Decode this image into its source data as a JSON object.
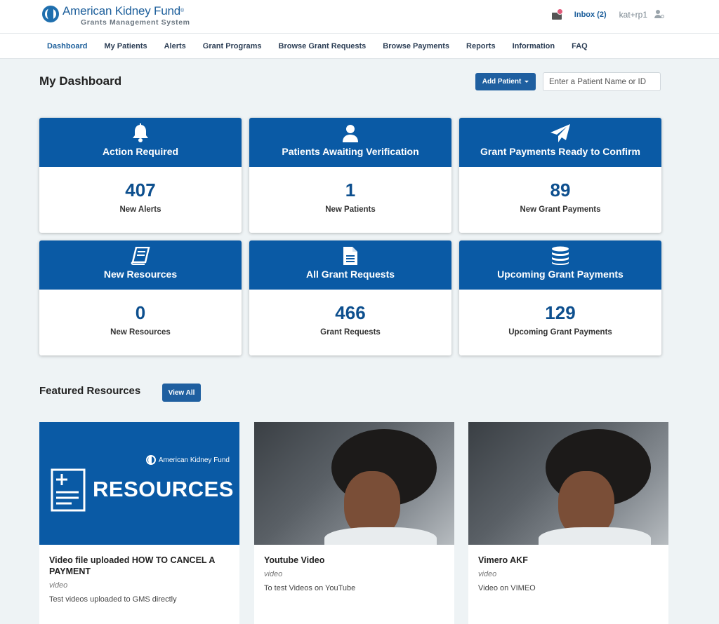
{
  "header": {
    "logo_name": "American Kidney Fund",
    "logo_reg": "®",
    "logo_sub": "Grants Management System",
    "inbox": "Inbox (2)",
    "user": "kat+rp1"
  },
  "nav": [
    "Dashboard",
    "My Patients",
    "Alerts",
    "Grant Programs",
    "Browse Grant Requests",
    "Browse Payments",
    "Reports",
    "Information",
    "FAQ"
  ],
  "page": {
    "title": "My Dashboard",
    "add_patient": "Add Patient",
    "search_placeholder": "Enter a Patient Name or ID"
  },
  "cards": [
    {
      "icon": "bell-icon",
      "label": "Action Required",
      "value": "407",
      "sub": "New Alerts"
    },
    {
      "icon": "user-icon",
      "label": "Patients Awaiting Verification",
      "value": "1",
      "sub": "New Patients"
    },
    {
      "icon": "paper-plane-icon",
      "label": "Grant Payments Ready to Confirm",
      "value": "89",
      "sub": "New Grant Payments"
    },
    {
      "icon": "book-icon",
      "label": "New Resources",
      "value": "0",
      "sub": "New Resources"
    },
    {
      "icon": "document-icon",
      "label": "All Grant Requests",
      "value": "466",
      "sub": "Grant Requests"
    },
    {
      "icon": "coins-icon",
      "label": "Upcoming Grant Payments",
      "value": "129",
      "sub": "Upcoming Grant Payments"
    }
  ],
  "featured": {
    "title": "Featured Resources",
    "view_all": "View All",
    "thumb_brand": "American Kidney Fund",
    "thumb_word": "RESOURCES",
    "items": [
      {
        "title": "Video file uploaded HOW TO CANCEL A PAYMENT",
        "type": "video",
        "desc": "Test videos uploaded to GMS directly"
      },
      {
        "title": "Youtube Video",
        "type": "video",
        "desc": "To test Videos on YouTube"
      },
      {
        "title": "Vimero AKF",
        "type": "video",
        "desc": "Video on VIMEO"
      }
    ]
  }
}
